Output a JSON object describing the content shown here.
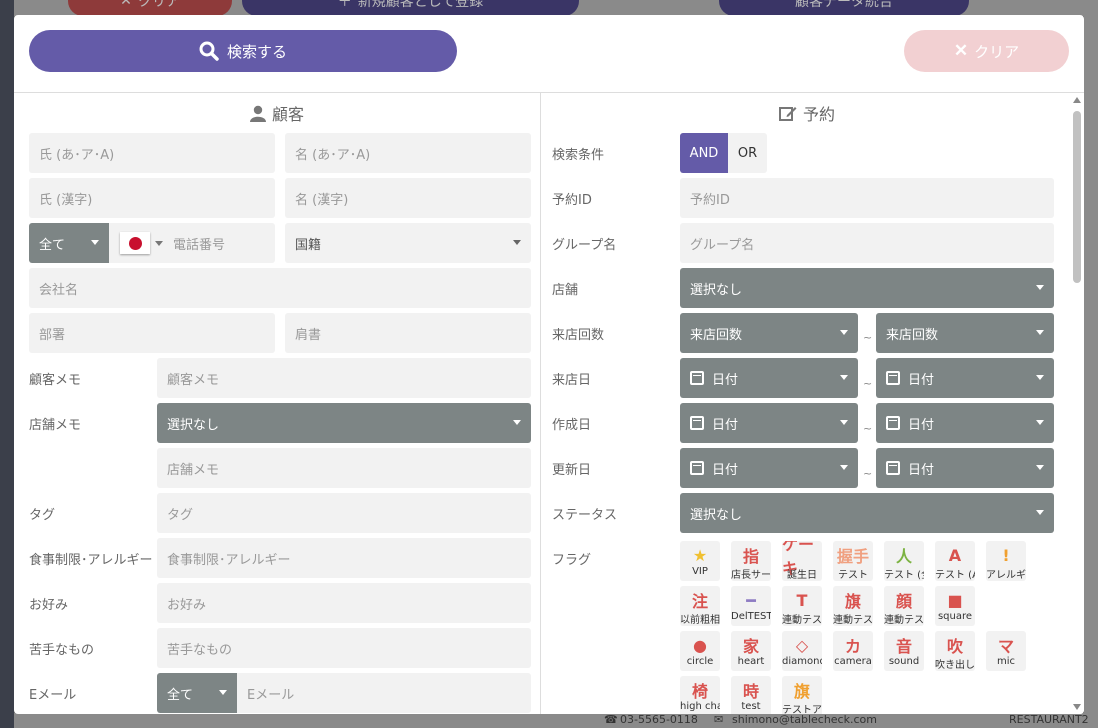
{
  "background": {
    "clear_label": "クリア",
    "register_label": "新規顧客として登録",
    "merge_label": "顧客データ統合",
    "phone": "03-5565-0118",
    "email": "shimono@tablecheck.com",
    "restaurant": "RESTAURANT2"
  },
  "header": {
    "search_label": "検索する",
    "clear_label": "クリア"
  },
  "customer": {
    "title": "顧客",
    "last_kana_ph": "氏 (あ･ア･A)",
    "first_kana_ph": "名 (あ･ア･A)",
    "last_kanji_ph": "氏 (漢字)",
    "first_kanji_ph": "名 (漢字)",
    "phone_type": "全て",
    "phone_ph": "電話番号",
    "nationality": "国籍",
    "company_ph": "会社名",
    "department_ph": "部署",
    "position_ph": "肩書",
    "customer_memo_label": "顧客メモ",
    "customer_memo_ph": "顧客メモ",
    "store_memo_label": "店舗メモ",
    "store_memo_select": "選択なし",
    "store_memo_ph": "店舗メモ",
    "tag_label": "タグ",
    "tag_ph": "タグ",
    "diet_label": "食事制限･アレルギー",
    "diet_ph": "食事制限･アレルギー",
    "likes_label": "お好み",
    "likes_ph": "お好み",
    "dislikes_label": "苦手なもの",
    "dislikes_ph": "苦手なもの",
    "email_label": "Eメール",
    "email_type": "全て",
    "email_ph": "Eメール"
  },
  "reservation": {
    "title": "予約",
    "condition_label": "検索条件",
    "and_label": "AND",
    "or_label": "OR",
    "id_label": "予約ID",
    "id_ph": "予約ID",
    "group_label": "グループ名",
    "group_ph": "グループ名",
    "store_label": "店舗",
    "store_select": "選択なし",
    "visits_label": "来店回数",
    "visits_from": "来店回数",
    "visits_to": "来店回数",
    "tilde": "~",
    "visit_date_label": "来店日",
    "created_label": "作成日",
    "updated_label": "更新日",
    "date_ph": "日付",
    "status_label": "ステータス",
    "status_select": "選択なし",
    "flags_label": "フラグ",
    "flags": [
      {
        "icon": "★",
        "label": "VIP",
        "color": "#f0c030"
      },
      {
        "icon": "指",
        "label": "店長サービス",
        "color": "#d9534f"
      },
      {
        "icon": "ケーキ",
        "label": "誕生日",
        "color": "#d9534f"
      },
      {
        "icon": "握手",
        "label": "テスト",
        "color": "#f0a080"
      },
      {
        "icon": "人",
        "label": "テスト (全員)",
        "color": "#7cb342"
      },
      {
        "icon": "A",
        "label": "テスト (A)",
        "color": "#d9534f"
      },
      {
        "icon": "!",
        "label": "アレルギー",
        "color": "#f0a030"
      },
      {
        "icon": "注",
        "label": "以前粗相",
        "color": "#d9534f"
      },
      {
        "icon": "━",
        "label": "DelTEST",
        "color": "#8e7cc3"
      },
      {
        "icon": "T",
        "label": "連動テスト",
        "color": "#d9534f"
      },
      {
        "icon": "旗",
        "label": "連動テスト",
        "color": "#d9534f"
      },
      {
        "icon": "顔",
        "label": "連動テスト",
        "color": "#d9534f"
      },
      {
        "icon": "■",
        "label": "square",
        "color": "#d9534f"
      },
      {
        "icon": "●",
        "label": "circle",
        "color": "#d9534f"
      },
      {
        "icon": "家",
        "label": "heart",
        "color": "#d9534f"
      },
      {
        "icon": "◇",
        "label": "diamond",
        "color": "#d9534f"
      },
      {
        "icon": "カ",
        "label": "camera",
        "color": "#d9534f"
      },
      {
        "icon": "音",
        "label": "sound",
        "color": "#d9534f"
      },
      {
        "icon": "吹",
        "label": "吹き出し",
        "color": "#d9534f"
      },
      {
        "icon": "マ",
        "label": "mic",
        "color": "#d9534f"
      },
      {
        "icon": "椅",
        "label": "high chair",
        "color": "#d9534f"
      },
      {
        "icon": "時",
        "label": "test",
        "color": "#d9534f"
      },
      {
        "icon": "旗",
        "label": "テストアイコン",
        "color": "#f0a030"
      }
    ]
  }
}
